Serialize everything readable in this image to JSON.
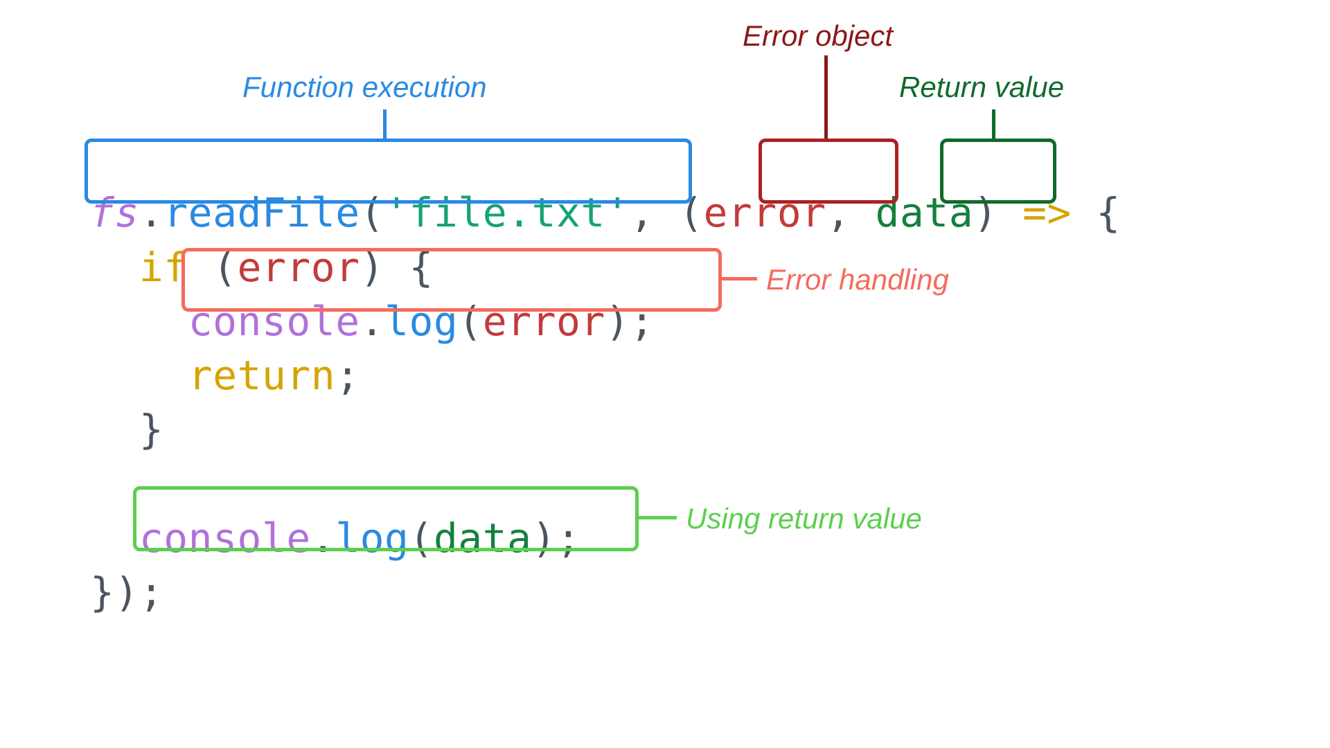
{
  "labels": {
    "func_exec": "Function execution",
    "error_obj": "Error object",
    "return_val": "Return value",
    "error_hand": "Error handling",
    "using_ret": "Using return value"
  },
  "code": {
    "fs": "fs",
    "dot1": ".",
    "readFile": "readFile",
    "lp1": "(",
    "str": "'file.txt'",
    "comma1": ",",
    "sp1": " ",
    "lp2": "(",
    "error": "error",
    "comma2": ",",
    "sp2": " ",
    "data": "data",
    "rp2": ")",
    "arrow": " => ",
    "lb1": "{",
    "if": "if",
    "sp3": " ",
    "lp3": "(",
    "error2": "error",
    "rp3": ")",
    "sp4": " ",
    "lb2": "{",
    "console1": "console",
    "dot2": ".",
    "log1": "log",
    "lp4": "(",
    "error3": "error",
    "rp4": ")",
    "semi1": ";",
    "return": "return",
    "semi2": ";",
    "rb2": "}",
    "console2": "console",
    "dot3": ".",
    "log2": "log",
    "lp5": "(",
    "data2": "data",
    "rp5": ")",
    "semi3": ";",
    "rb1": "}",
    "rp1": ")",
    "semi4": ";"
  }
}
